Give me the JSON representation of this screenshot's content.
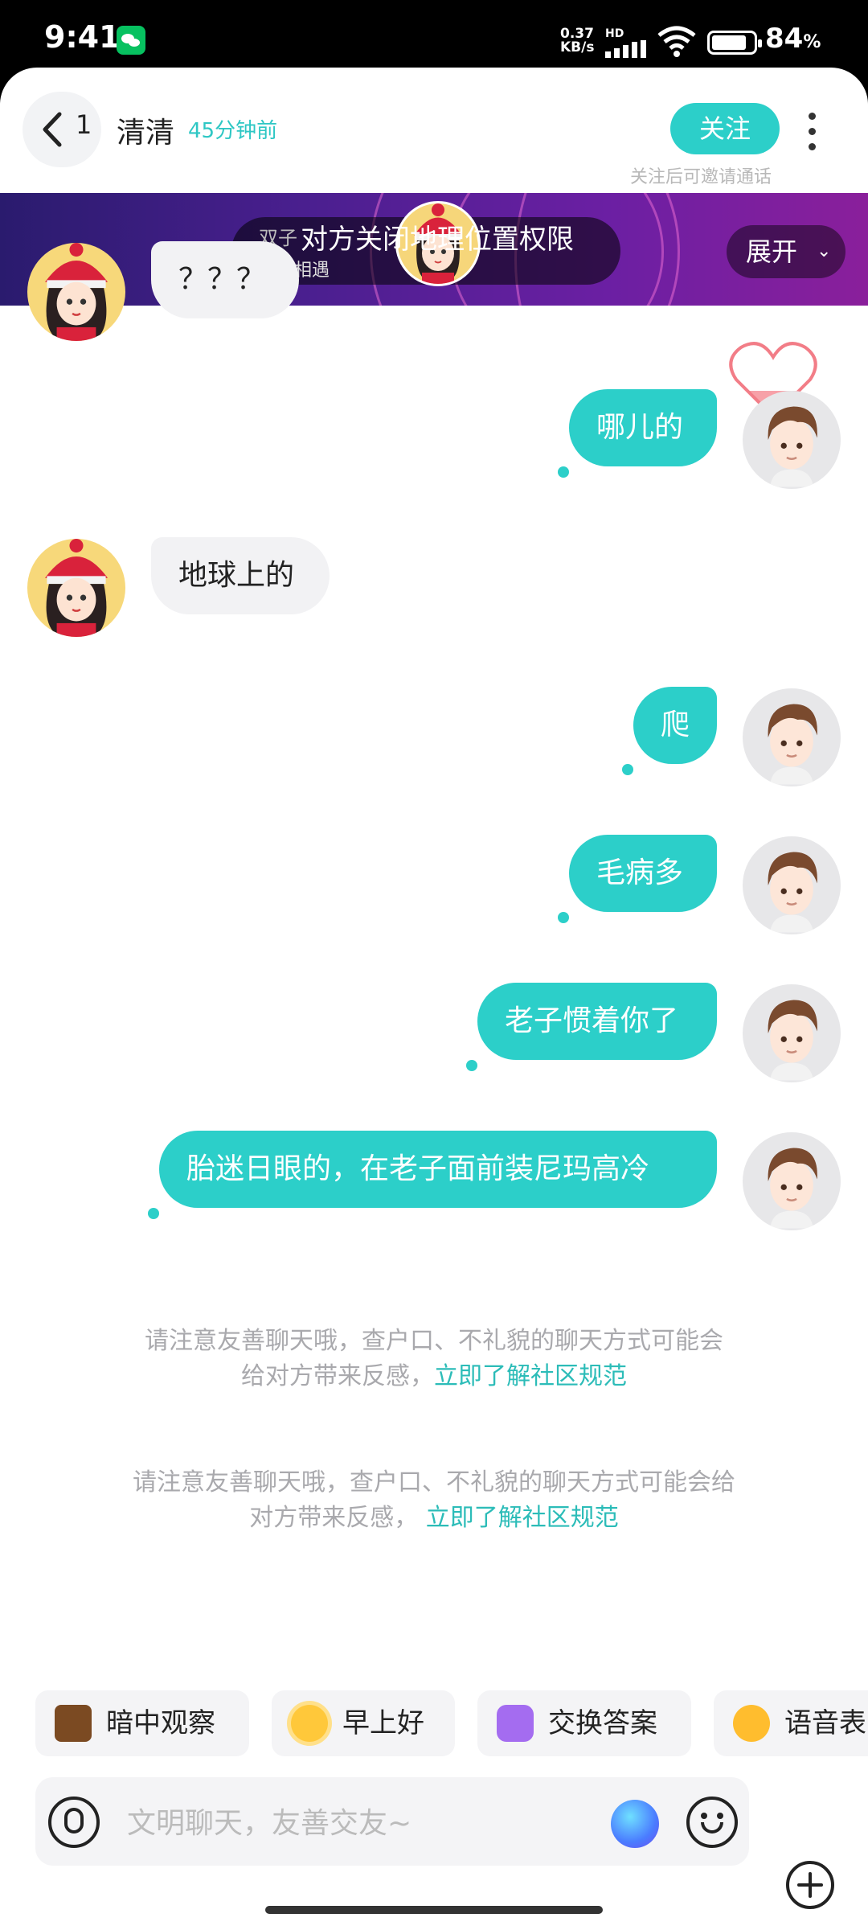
{
  "status_bar": {
    "time": "9:41",
    "net_speed_top": "0.37",
    "net_speed_bottom": "KB/s",
    "hd_label": "HD",
    "battery_percent_value": 84,
    "battery_percent": "84",
    "battery_percent_sign": "%"
  },
  "header": {
    "back_count": "1",
    "name": "清清",
    "last_seen": "45分钟前",
    "follow_label": "关注",
    "follow_hint": "关注后可邀请通话"
  },
  "banner": {
    "side_text_1": "双子",
    "side_text_2": "同城相遇",
    "notice": "对方关闭地理位置权限",
    "expand_label": "展开"
  },
  "messages": [
    {
      "direction": "in",
      "text": "？？？"
    },
    {
      "direction": "out",
      "text": "哪儿的"
    },
    {
      "direction": "in",
      "text": "地球上的"
    },
    {
      "direction": "out",
      "text": "爬"
    },
    {
      "direction": "out",
      "text": "毛病多"
    },
    {
      "direction": "out",
      "text": "老子惯着你了"
    },
    {
      "direction": "out",
      "text": "胎迷日眼的，在老子面前装尼玛高冷"
    }
  ],
  "notices": [
    {
      "line1": "请注意友善聊天哦，查户口、不礼貌的聊天方式可能会",
      "line2": "给对方带来反感，",
      "link": "立即了解社区规范"
    },
    {
      "line1": "请注意友善聊天哦，查户口、不礼貌的聊天方式可能会给",
      "line2": "对方带来反感，",
      "link": "立即了解社区规范"
    }
  ],
  "quick_replies": [
    {
      "label": "暗中观察",
      "icon": "peek-icon",
      "color": "#c98a3a"
    },
    {
      "label": "早上好",
      "icon": "sun-icon",
      "color": "#ffc83a"
    },
    {
      "label": "交换答案",
      "icon": "exchange-icon",
      "color": "#a46cf0"
    },
    {
      "label": "语音表",
      "icon": "voice-face-icon",
      "color": "#ffbd2e"
    }
  ],
  "input": {
    "placeholder": "文明聊天，友善交友~"
  },
  "colors": {
    "accent": "#2ccfc9",
    "incoming_bubble": "#f2f2f4",
    "banner_start": "#2a1b6e",
    "banner_end": "#8a1f9b"
  }
}
